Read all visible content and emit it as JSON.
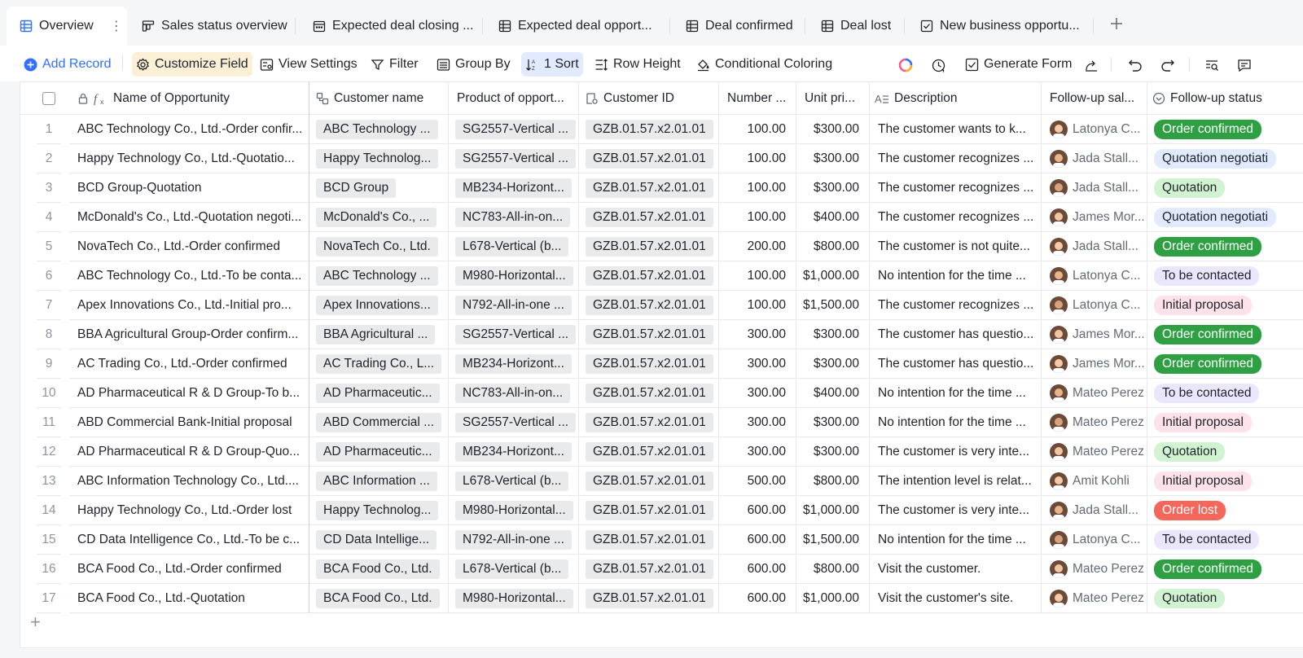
{
  "tabs": [
    {
      "label": "Overview",
      "icon": "grid-table-icon",
      "active": true
    },
    {
      "label": "Sales status overview",
      "icon": "kanban-icon"
    },
    {
      "label": "Expected deal closing ...",
      "icon": "calendar-icon"
    },
    {
      "label": "Expected deal opport...",
      "icon": "grid-table-icon"
    },
    {
      "label": "Deal confirmed",
      "icon": "grid-table-icon"
    },
    {
      "label": "Deal lost",
      "icon": "grid-table-icon"
    },
    {
      "label": "New business opportu...",
      "icon": "form-check-icon"
    }
  ],
  "toolbar": {
    "add_record": "Add Record",
    "customize_field": "Customize Field",
    "view_settings": "View Settings",
    "filter": "Filter",
    "group_by": "Group By",
    "sort": "1 Sort",
    "row_height": "Row Height",
    "conditional_coloring": "Conditional Coloring",
    "generate_form": "Generate Form"
  },
  "columns": {
    "name": "Name of Opportunity",
    "customer": "Customer name",
    "product": "Product of opport...",
    "customer_id": "Customer ID",
    "number": "Number ...",
    "unit_price": "Unit pri...",
    "description": "Description",
    "followup_sales": "Follow-up sal...",
    "followup_status": "Follow-up status"
  },
  "rows": [
    {
      "n": "1",
      "name": "ABC Technology Co., Ltd.-Order confir...",
      "customer": "ABC Technology ...",
      "product": "SG2557-Vertical ...",
      "cid": "GZB.01.57.x2.01.01",
      "number": "100.00",
      "price": "$300.00",
      "desc": "The customer wants to k...",
      "sales": "Latonya C...",
      "status": "Order confirmed",
      "status_key": "order_confirmed"
    },
    {
      "n": "2",
      "name": "Happy Technology Co., Ltd.-Quotatio...",
      "customer": "Happy Technolog...",
      "product": "SG2557-Vertical ...",
      "cid": "GZB.01.57.x2.01.01",
      "number": "100.00",
      "price": "$300.00",
      "desc": "The customer recognizes ...",
      "sales": "Jada Stall...",
      "status": "Quotation negotiati",
      "status_key": "quotation_negotiation"
    },
    {
      "n": "3",
      "name": "BCD Group-Quotation",
      "customer": "BCD Group",
      "product": "MB234-Horizont...",
      "cid": "GZB.01.57.x2.01.01",
      "number": "100.00",
      "price": "$300.00",
      "desc": "The customer recognizes ...",
      "sales": "Jada Stall...",
      "status": "Quotation",
      "status_key": "quotation"
    },
    {
      "n": "4",
      "name": "McDonald's Co., Ltd.-Quotation negoti...",
      "customer": "McDonald's Co., ...",
      "product": "NC783-All-in-on...",
      "cid": "GZB.01.57.x2.01.01",
      "number": "100.00",
      "price": "$400.00",
      "desc": "The customer recognizes ...",
      "sales": "James Mor...",
      "status": "Quotation negotiati",
      "status_key": "quotation_negotiation"
    },
    {
      "n": "5",
      "name": "NovaTech Co., Ltd.-Order confirmed",
      "customer": "NovaTech Co., Ltd.",
      "product": "L678-Vertical (b...",
      "cid": "GZB.01.57.x2.01.01",
      "number": "200.00",
      "price": "$800.00",
      "desc": "The customer is not quite...",
      "sales": "Jada Stall...",
      "status": "Order confirmed",
      "status_key": "order_confirmed"
    },
    {
      "n": "6",
      "name": "ABC Technology Co., Ltd.-To be conta...",
      "customer": "ABC Technology ...",
      "product": "M980-Horizontal...",
      "cid": "GZB.01.57.x2.01.01",
      "number": "100.00",
      "price": "$1,000.00",
      "desc": "No intention for the time ...",
      "sales": "Latonya C...",
      "status": "To be contacted",
      "status_key": "to_be_contacted"
    },
    {
      "n": "7",
      "name": "Apex Innovations Co., Ltd.-Initial pro...",
      "customer": "Apex Innovations...",
      "product": "N792-All-in-one ...",
      "cid": "GZB.01.57.x2.01.01",
      "number": "100.00",
      "price": "$1,500.00",
      "desc": "The customer recognizes ...",
      "sales": "Latonya C...",
      "status": "Initial proposal",
      "status_key": "initial_proposal"
    },
    {
      "n": "8",
      "name": "BBA Agricultural Group-Order confirm...",
      "customer": "BBA Agricultural ...",
      "product": "SG2557-Vertical ...",
      "cid": "GZB.01.57.x2.01.01",
      "number": "300.00",
      "price": "$300.00",
      "desc": "The customer has questio...",
      "sales": "James Mor...",
      "status": "Order confirmed",
      "status_key": "order_confirmed"
    },
    {
      "n": "9",
      "name": "AC Trading Co., Ltd.-Order confirmed",
      "customer": "AC Trading Co., L...",
      "product": "MB234-Horizont...",
      "cid": "GZB.01.57.x2.01.01",
      "number": "300.00",
      "price": "$300.00",
      "desc": "The customer has questio...",
      "sales": "James Mor...",
      "status": "Order confirmed",
      "status_key": "order_confirmed"
    },
    {
      "n": "10",
      "name": "AD Pharmaceutical R & D Group-To b...",
      "customer": "AD Pharmaceutic...",
      "product": "NC783-All-in-on...",
      "cid": "GZB.01.57.x2.01.01",
      "number": "300.00",
      "price": "$400.00",
      "desc": "No intention for the time ...",
      "sales": "Mateo Perez",
      "status": "To be contacted",
      "status_key": "to_be_contacted"
    },
    {
      "n": "11",
      "name": "ABD Commercial Bank-Initial proposal",
      "customer": "ABD Commercial ...",
      "product": "SG2557-Vertical ...",
      "cid": "GZB.01.57.x2.01.01",
      "number": "300.00",
      "price": "$300.00",
      "desc": "No intention for the time ...",
      "sales": "Mateo Perez",
      "status": "Initial proposal",
      "status_key": "initial_proposal"
    },
    {
      "n": "12",
      "name": "AD Pharmaceutical R & D Group-Quo...",
      "customer": "AD Pharmaceutic...",
      "product": "MB234-Horizont...",
      "cid": "GZB.01.57.x2.01.01",
      "number": "300.00",
      "price": "$300.00",
      "desc": "The customer is very inte...",
      "sales": "Mateo Perez",
      "status": "Quotation",
      "status_key": "quotation"
    },
    {
      "n": "13",
      "name": "ABC Information Technology Co., Ltd....",
      "customer": "ABC Information ...",
      "product": "L678-Vertical (b...",
      "cid": "GZB.01.57.x2.01.01",
      "number": "500.00",
      "price": "$800.00",
      "desc": "The intention level is relat...",
      "sales": "Amit Kohli",
      "status": "Initial proposal",
      "status_key": "initial_proposal"
    },
    {
      "n": "14",
      "name": "Happy Technology Co., Ltd.-Order lost",
      "customer": "Happy Technolog...",
      "product": "M980-Horizontal...",
      "cid": "GZB.01.57.x2.01.01",
      "number": "600.00",
      "price": "$1,000.00",
      "desc": "The customer is very inte...",
      "sales": "Jada Stall...",
      "status": "Order lost",
      "status_key": "order_lost"
    },
    {
      "n": "15",
      "name": "CD Data Intelligence Co., Ltd.-To be c...",
      "customer": "CD Data Intellige...",
      "product": "N792-All-in-one ...",
      "cid": "GZB.01.57.x2.01.01",
      "number": "600.00",
      "price": "$1,500.00",
      "desc": "No intention for the time ...",
      "sales": "Latonya C...",
      "status": "To be contacted",
      "status_key": "to_be_contacted"
    },
    {
      "n": "16",
      "name": "BCA Food Co., Ltd.-Order confirmed",
      "customer": "BCA Food Co., Ltd.",
      "product": "L678-Vertical (b...",
      "cid": "GZB.01.57.x2.01.01",
      "number": "600.00",
      "price": "$800.00",
      "desc": "Visit the customer.",
      "sales": "Mateo Perez",
      "status": "Order confirmed",
      "status_key": "order_confirmed"
    },
    {
      "n": "17",
      "name": "BCA Food Co., Ltd.-Quotation",
      "customer": "BCA Food Co., Ltd.",
      "product": "M980-Horizontal...",
      "cid": "GZB.01.57.x2.01.01",
      "number": "600.00",
      "price": "$1,000.00",
      "desc": "Visit the customer's site.",
      "sales": "Mateo Perez",
      "status": "Quotation",
      "status_key": "quotation"
    }
  ],
  "colors": {
    "accent": "#3370ff",
    "order_confirmed": "#2ea043",
    "order_lost": "#f5675b"
  }
}
